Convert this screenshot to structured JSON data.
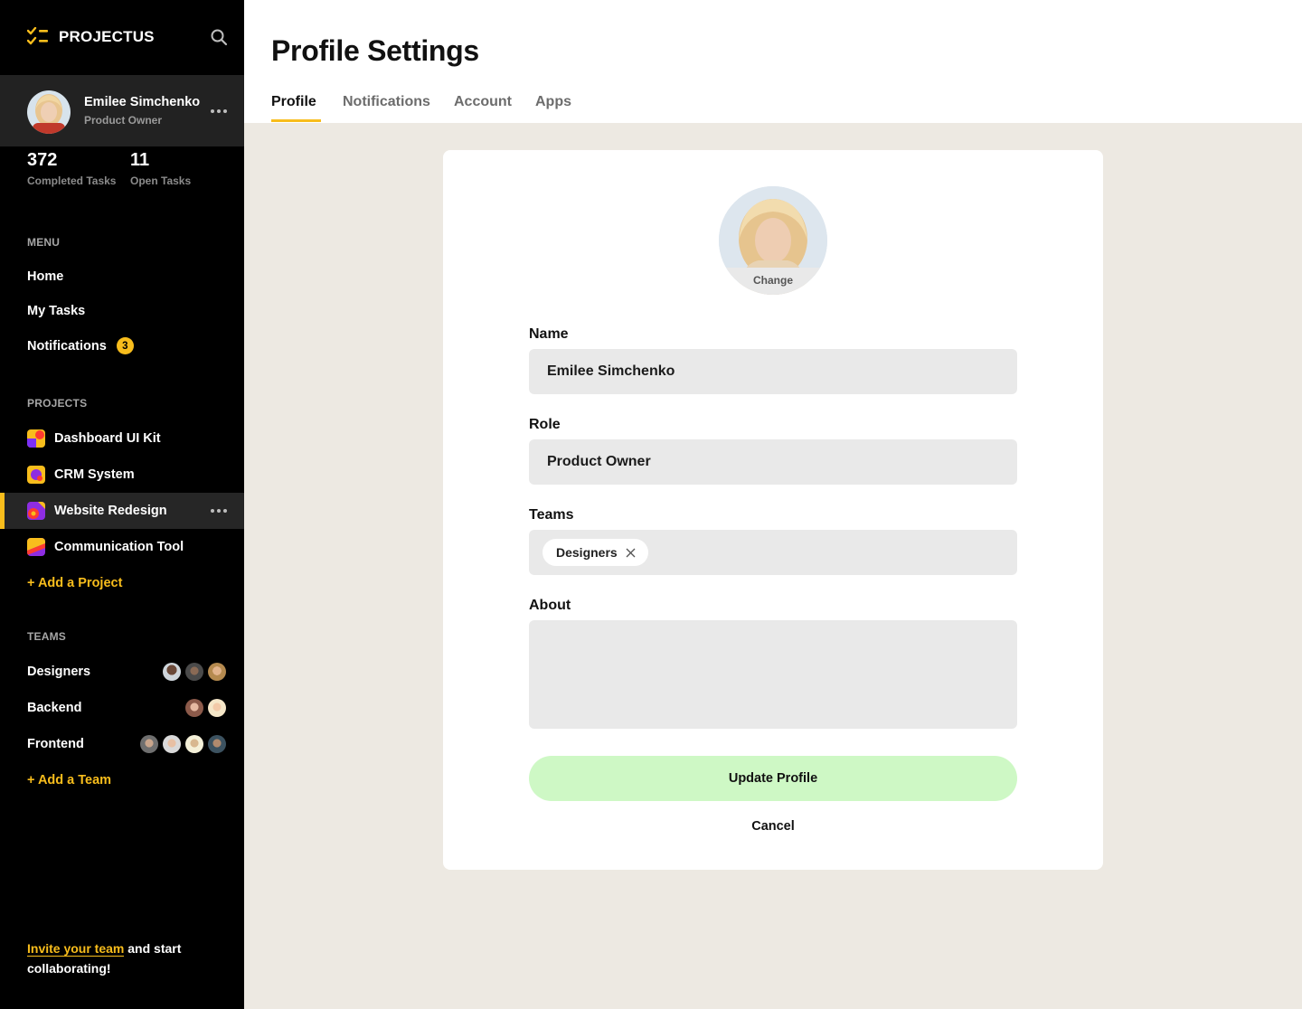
{
  "app": {
    "name": "PROJECTUS"
  },
  "user": {
    "name": "Emilee Simchenko",
    "role": "Product Owner"
  },
  "stats": [
    {
      "value": "372",
      "label": "Completed Tasks"
    },
    {
      "value": "11",
      "label": "Open Tasks"
    }
  ],
  "menu": {
    "heading": "MENU",
    "items": [
      {
        "label": "Home"
      },
      {
        "label": "My Tasks"
      },
      {
        "label": "Notifications",
        "badge": "3"
      }
    ]
  },
  "projects": {
    "heading": "PROJECTS",
    "items": [
      {
        "label": "Dashboard UI Kit"
      },
      {
        "label": "CRM System"
      },
      {
        "label": "Website Redesign",
        "active": true
      },
      {
        "label": "Communication Tool"
      }
    ],
    "add_label": "+ Add a Project"
  },
  "teams": {
    "heading": "TEAMS",
    "items": [
      {
        "label": "Designers",
        "member_count": 3
      },
      {
        "label": "Backend",
        "member_count": 2
      },
      {
        "label": "Frontend",
        "member_count": 4
      }
    ],
    "add_label": "+ Add a Team"
  },
  "invite": {
    "link": "Invite your team",
    "text": " and start collaborating!"
  },
  "page": {
    "title": "Profile Settings",
    "tabs": [
      {
        "label": "Profile",
        "active": true
      },
      {
        "label": "Notifications"
      },
      {
        "label": "Account"
      },
      {
        "label": "Apps"
      }
    ]
  },
  "form": {
    "photo_change": "Change",
    "name": {
      "label": "Name",
      "value": "Emilee Simchenko"
    },
    "role": {
      "label": "Role",
      "value": "Product Owner"
    },
    "teams": {
      "label": "Teams",
      "chips": [
        "Designers"
      ]
    },
    "about": {
      "label": "About",
      "value": ""
    },
    "submit": "Update Profile",
    "cancel": "Cancel"
  },
  "colors": {
    "accent": "#f8bd1c",
    "sidebar": "#000000",
    "submit_bg": "#cef8c5",
    "page_bg": "#ede9e2"
  }
}
